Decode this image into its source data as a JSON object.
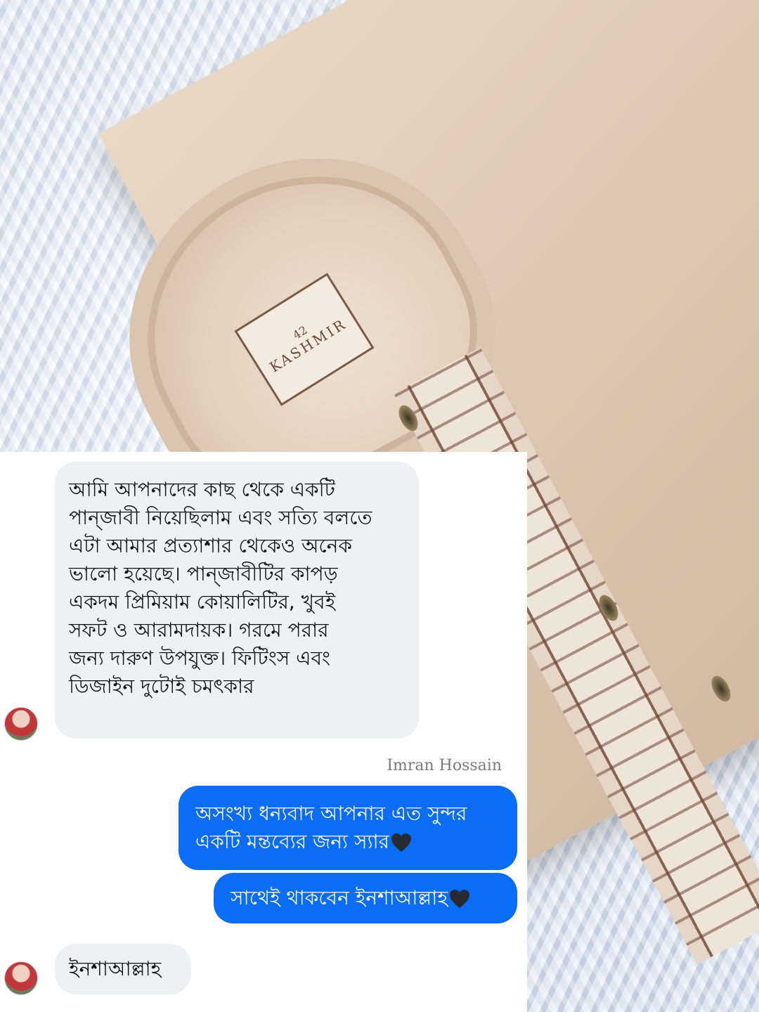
{
  "background": {
    "label_brand": "KASHMIR",
    "label_size": "42"
  },
  "chat": {
    "messages": [
      {
        "direction": "incoming",
        "text": "আমি আপনাদের কাছ থেকে একটি\nপান্জাবী নিয়েছিলাম এবং সত্যি বলতে\nএটা আমার প্রত্যাশার থেকেও অনেক\nভালো হয়েছে। পান্জাবীটির কাপড়\nএকদম প্রিমিয়াম কোয়ালিটির, খুবই\nসফট ও আরামদায়ক। গরমে পরার\nজন্য দারুণ উপযুক্ত। ফিটিংস এবং\nডিজাইন দুটোই চমৎকার"
      },
      {
        "direction": "outgoing",
        "sender_name": "Imran Hossain",
        "text": "অসংখ্য ধন্যবাদ আপনার এত সুন্দর\nএকটি মন্তব্যের জন্য স্যার",
        "emoji": "black-heart"
      },
      {
        "direction": "outgoing",
        "text": "সাথেই থাকবেন ইনশাআল্লাহ",
        "emoji": "black-heart"
      },
      {
        "direction": "incoming",
        "text": "ইনশাআল্লাহ"
      }
    ]
  },
  "colors": {
    "incoming_bubble": "#eff0f3",
    "outgoing_bubble": "#0b6cf5",
    "panel_background": "#ffffff"
  }
}
